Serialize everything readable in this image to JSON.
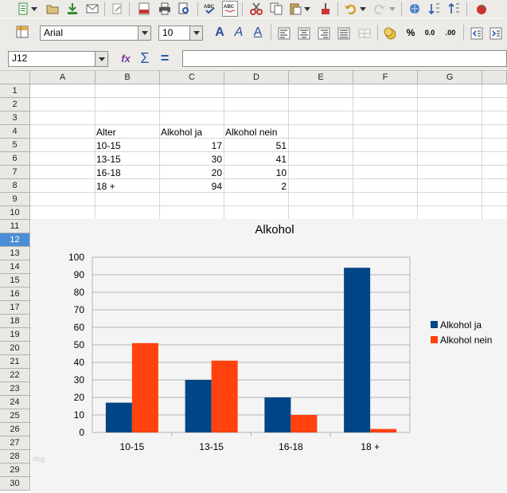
{
  "font": {
    "name": "Arial",
    "size": "10"
  },
  "formula_bar": {
    "cell_ref": "J12",
    "formula": ""
  },
  "columns": [
    "A",
    "B",
    "C",
    "D",
    "E",
    "F",
    "G"
  ],
  "rows": [
    "1",
    "2",
    "3",
    "4",
    "5",
    "6",
    "7",
    "8",
    "9",
    "10",
    "11",
    "12",
    "13",
    "14",
    "15",
    "16",
    "17",
    "18",
    "19",
    "20",
    "21",
    "22",
    "23",
    "24",
    "25",
    "26",
    "27",
    "28",
    "29",
    "30"
  ],
  "active_row": "12",
  "table": {
    "headers": [
      "Alter",
      "Alkohol ja",
      "Alkohol nein"
    ],
    "rows": [
      [
        "10-15",
        "17",
        "51"
      ],
      [
        "13-15",
        "30",
        "41"
      ],
      [
        "16-18",
        "20",
        "10"
      ],
      [
        "18 +",
        "94",
        "2"
      ]
    ]
  },
  "watermark": "dog",
  "colors": {
    "series_ja": "#004586",
    "series_nein": "#ff420e",
    "active_row": "#4a8fd6"
  },
  "icons": [
    "new-icon",
    "open-icon",
    "save-icon",
    "email-icon",
    "edit-icon",
    "pdf-icon",
    "print-icon",
    "print-preview-icon",
    "spellcheck-icon",
    "autospell-icon",
    "cut-icon",
    "copy-icon",
    "paste-icon",
    "clone-format-icon",
    "undo-icon",
    "redo-icon",
    "hyperlink-icon",
    "sort-asc-icon",
    "sort-desc-icon",
    "gallery-icon"
  ],
  "chart_data": {
    "type": "bar",
    "title": "Alkohol",
    "categories": [
      "10-15",
      "13-15",
      "16-18",
      "18 +"
    ],
    "series": [
      {
        "name": "Alkohol ja",
        "values": [
          17,
          30,
          20,
          94
        ],
        "color": "#004586"
      },
      {
        "name": "Alkohol nein",
        "values": [
          51,
          41,
          10,
          2
        ],
        "color": "#ff420e"
      }
    ],
    "ylim": [
      0,
      100
    ],
    "yticks": [
      0,
      10,
      20,
      30,
      40,
      50,
      60,
      70,
      80,
      90,
      100
    ],
    "grid": true,
    "legend": "right"
  }
}
